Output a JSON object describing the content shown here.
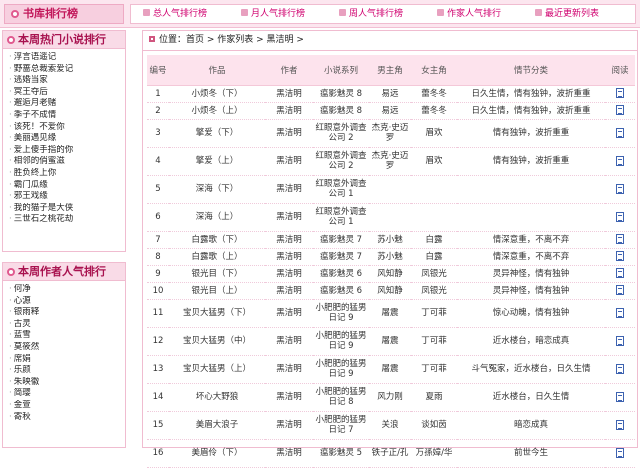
{
  "site": {
    "title": "书库排行榜"
  },
  "topnav": [
    "总人气排行榜",
    "月人气排行榜",
    "周人气排行榜",
    "作家人气排行",
    "最近更新列表"
  ],
  "sidebar": {
    "hot_novels": {
      "title": "本周热门小说排行",
      "items": [
        "浮言语遥记",
        "野蔷总裁索爱记",
        "逃婚当家",
        "冥王夺后",
        "邂逅月老赌",
        "季子不成情",
        "该死！不爱你",
        "美丽遇见缘",
        "爱上傻手指的你",
        "相邻的俏蜜滋",
        "胜负终上你",
        "霸门瓜缘",
        "邪王戏缘",
        "我的猫子是大侠",
        "三世石之桃花劫"
      ]
    },
    "hot_authors": {
      "title": "本周作者人气排行",
      "items": [
        "何净",
        "心源",
        "银雨释",
        "古灵",
        "蓝雪",
        "莫筱然",
        "席娟",
        "乐颜",
        "朱映徽",
        "简璎",
        "金萱",
        "寄秋"
      ]
    }
  },
  "breadcrumb": "位置：首页 > 作家列表 > 黑洁明 >",
  "table": {
    "columns": [
      "编号",
      "作品",
      "作者",
      "小说系列",
      "男主角",
      "女主角",
      "情节分类",
      "阅读"
    ],
    "rows": [
      {
        "no": "1",
        "title": "小烦冬（下）",
        "author": "黑洁明",
        "series": "瘟影魅灵 8",
        "male": "易远",
        "female": "蕾冬冬",
        "genre": "日久生情，情有独钟，波折重重",
        "size": "r1"
      },
      {
        "no": "2",
        "title": "小烦冬（上）",
        "author": "黑洁明",
        "series": "瘟影魅灵 8",
        "male": "易远",
        "female": "蕾冬冬",
        "genre": "日久生情，情有独钟，波折重重",
        "size": "r1"
      },
      {
        "no": "3",
        "title": "擎爱（下）",
        "author": "黑洁明",
        "series": "红眼意外调查公司 2",
        "male": "杰克·史迈罗",
        "female": "眉欢",
        "genre": "情有独钟，波折重重",
        "size": "r2"
      },
      {
        "no": "4",
        "title": "擎爱（上）",
        "author": "黑洁明",
        "series": "红眼意外调查公司 2",
        "male": "杰克·史迈罗",
        "female": "眉欢",
        "genre": "情有独钟，波折重重",
        "size": "r2"
      },
      {
        "no": "5",
        "title": "深海（下）",
        "author": "黑洁明",
        "series": "红眼意外调查公司 1",
        "male": "",
        "female": "",
        "genre": "",
        "size": "r2"
      },
      {
        "no": "6",
        "title": "深海（上）",
        "author": "黑洁明",
        "series": "红眼意外调查公司 1",
        "male": "",
        "female": "",
        "genre": "",
        "size": "r2"
      },
      {
        "no": "7",
        "title": "白露歌（下）",
        "author": "黑洁明",
        "series": "瘟影魅灵 7",
        "male": "苏小魅",
        "female": "白露",
        "genre": "情深意重，不离不弃",
        "size": "r1"
      },
      {
        "no": "8",
        "title": "白露歌（上）",
        "author": "黑洁明",
        "series": "瘟影魅灵 7",
        "male": "苏小魅",
        "female": "白露",
        "genre": "情深意重，不离不弃",
        "size": "r1"
      },
      {
        "no": "9",
        "title": "银光目（下）",
        "author": "黑洁明",
        "series": "瘟影魅灵 6",
        "male": "风知静",
        "female": "凤银光",
        "genre": "灵异神怪，情有独钟",
        "size": "r1"
      },
      {
        "no": "10",
        "title": "银光目（上）",
        "author": "黑洁明",
        "series": "瘟影魅灵 6",
        "male": "风知静",
        "female": "凤银光",
        "genre": "灵异神怪，情有独钟",
        "size": "r1"
      },
      {
        "no": "11",
        "title": "宝贝大猛男（下）",
        "author": "黑洁明",
        "series": "小肥肥的猛男日记 9",
        "male": "屠震",
        "female": "丁可菲",
        "genre": "惊心动魄，情有独钟",
        "size": "r2"
      },
      {
        "no": "12",
        "title": "宝贝大猛男（中）",
        "author": "黑洁明",
        "series": "小肥肥的猛男日记 9",
        "male": "屠震",
        "female": "丁可菲",
        "genre": "近水楼台，暗恋成真",
        "size": "r2"
      },
      {
        "no": "13",
        "title": "宝贝大猛男（上）",
        "author": "黑洁明",
        "series": "小肥肥的猛男日记 9",
        "male": "屠震",
        "female": "丁可菲",
        "genre": "斗气冤家，近水楼台，日久生情",
        "size": "r2"
      },
      {
        "no": "14",
        "title": "坏心大野狼",
        "author": "黑洁明",
        "series": "小肥肥的猛男日记 8",
        "male": "风力刚",
        "female": "夏雨",
        "genre": "近水楼台，日久生情",
        "size": "r2"
      },
      {
        "no": "15",
        "title": "美眉大浪子",
        "author": "黑洁明",
        "series": "小肥肥的猛男日记 7",
        "male": "关浪",
        "female": "谈如茵",
        "genre": "暗恋成真",
        "size": "r2"
      },
      {
        "no": "16",
        "title": "美眉伶（下）",
        "author": "黑洁明",
        "series": "瘟影魅灵 5",
        "male": "铁子正/孔",
        "female": "万孫嫜/华",
        "genre": "前世今生",
        "size": "r2"
      }
    ]
  }
}
